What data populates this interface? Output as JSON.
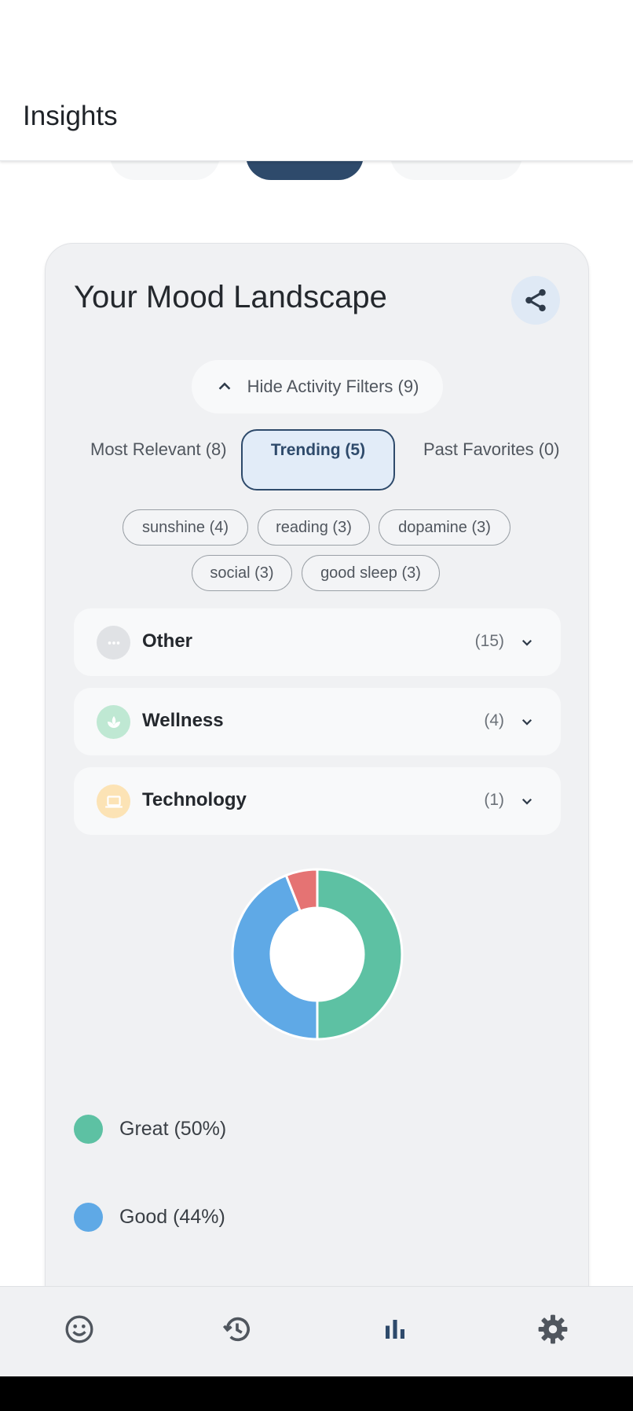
{
  "header": {
    "title": "Insights"
  },
  "card": {
    "title": "Your Mood Landscape",
    "share_icon": "share-icon",
    "filter_toggle_label": "Hide Activity Filters (9)",
    "segments": [
      {
        "label": "Most Relevant (8)",
        "selected": false
      },
      {
        "label": "Trending (5)",
        "selected": true
      },
      {
        "label": "Past Favorites (0)",
        "selected": false
      }
    ],
    "chips": [
      "sunshine (4)",
      "reading (3)",
      "dopamine (3)",
      "social (3)",
      "good sleep (3)"
    ],
    "categories": [
      {
        "name": "Other",
        "count": "(15)",
        "icon": "more-horiz-icon",
        "icon_color": "#e0e2e5"
      },
      {
        "name": "Wellness",
        "count": "(4)",
        "icon": "spa-icon",
        "icon_color": "#bfe8d3"
      },
      {
        "name": "Technology",
        "count": "(1)",
        "icon": "laptop-icon",
        "icon_color": "#fce3b5"
      }
    ]
  },
  "chart_data": {
    "type": "pie",
    "donut": true,
    "slices": [
      {
        "label": "Great",
        "value": 50,
        "color": "#5dc1a3"
      },
      {
        "label": "Good",
        "value": 44,
        "color": "#5fa9e6"
      },
      {
        "label": "",
        "value": 6,
        "color": "#e57373"
      }
    ],
    "legend": [
      "Great (50%)",
      "Good (44%)"
    ]
  },
  "bottom_nav": [
    {
      "icon": "mood-icon",
      "active": false
    },
    {
      "icon": "history-icon",
      "active": false
    },
    {
      "icon": "insights-bar-chart-icon",
      "active": true
    },
    {
      "icon": "settings-gear-icon",
      "active": false
    }
  ]
}
